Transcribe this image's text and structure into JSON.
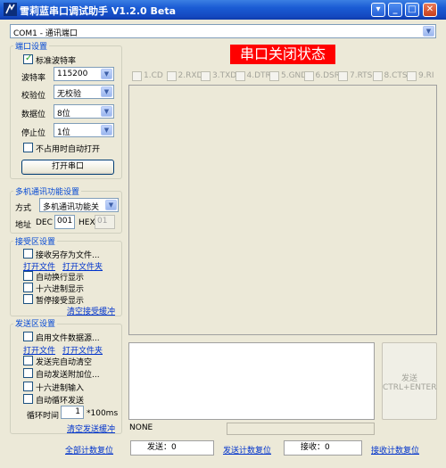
{
  "window": {
    "title": "雪莉蓝串口调试助手 V1.2.0 Beta",
    "controls": {
      "menu": "▾",
      "minimize": "_",
      "maximize": "□",
      "close": "✕"
    }
  },
  "port_select": {
    "value": "COM1 - 通讯端口"
  },
  "port_settings": {
    "legend": "端口设置",
    "standard_baud": {
      "label": "标准波特率",
      "checked": true
    },
    "baud": {
      "label": "波特率",
      "value": "115200"
    },
    "parity": {
      "label": "校验位",
      "value": "无校验"
    },
    "databits": {
      "label": "数据位",
      "value": "8位"
    },
    "stopbits": {
      "label": "停止位",
      "value": "1位"
    },
    "auto_open": {
      "label": "不占用时自动打开",
      "checked": false
    },
    "open_button": "打开串口"
  },
  "multi": {
    "legend": "多机通讯功能设置",
    "mode_label": "方式",
    "mode_value": "多机通讯功能关",
    "addr_label": "地址",
    "dec_label": "DEC",
    "dec_value": "001",
    "hex_label": "HEX",
    "hex_value": "01"
  },
  "recv": {
    "legend": "接受区设置",
    "save_to_file": "接收另存为文件...",
    "open_file": "打开文件",
    "open_folder": "打开文件夹",
    "auto_newline": "自动换行显示",
    "hex_display": "十六进制显示",
    "pause": "暂停接受显示",
    "clear": "清空接受缓冲"
  },
  "send": {
    "legend": "发送区设置",
    "enable_file": "启用文件数据源...",
    "open_file": "打开文件",
    "open_folder": "打开文件夹",
    "auto_clear": "发送完自动清空",
    "auto_append": "自动发送附加位...",
    "hex_input": "十六进制输入",
    "loop_send": "自动循环发送",
    "cycle_label": "循环时间",
    "cycle_value": "1",
    "cycle_unit": "*100ms",
    "clear": "清空发送缓冲"
  },
  "status": {
    "port_state": "串口关闭状态"
  },
  "signals": [
    "1.CD",
    "2.RXD",
    "3.TXD",
    "4.DTR",
    "5.GND",
    "6.DSR",
    "7.RTS",
    "8.CTS",
    "9.RI"
  ],
  "send_button": {
    "line1": "发送",
    "line2": "CTRL+ENTER"
  },
  "send_status": "NONE",
  "footer": {
    "reset_all": "全部计数复位",
    "sent_label": "发送：",
    "sent_value": "0",
    "reset_send": "发送计数复位",
    "recv_label": "接收：",
    "recv_value": "0",
    "reset_recv": "接收计数复位"
  },
  "colors": {
    "accent": "#0046d5",
    "status_bg": "#ff0000",
    "titlebar": "#1a5bd4"
  }
}
